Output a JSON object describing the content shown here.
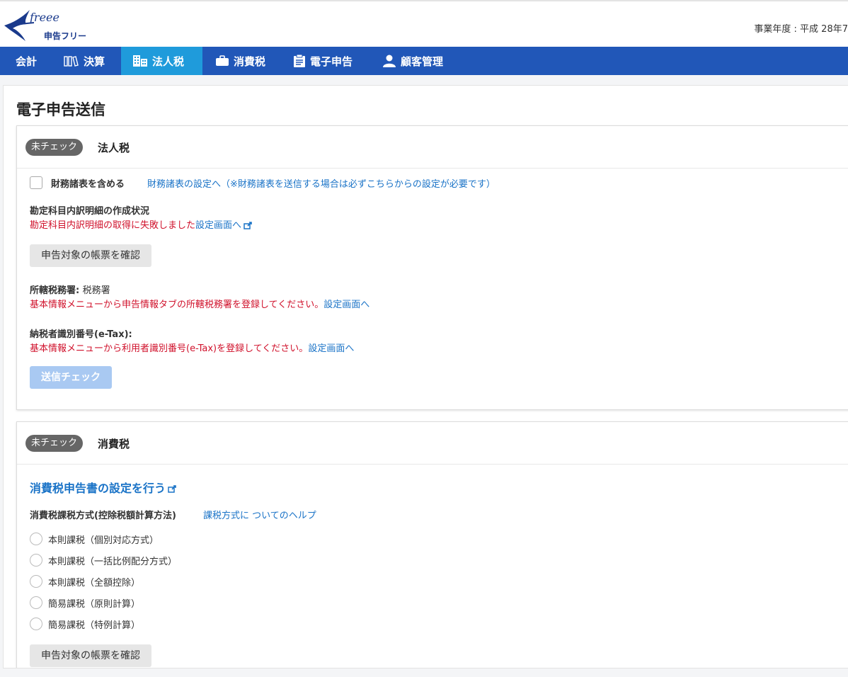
{
  "header": {
    "logo_script": "freee",
    "logo_sub": "申告フリー",
    "fiscal_year": "事業年度 : 平成 28年7"
  },
  "nav": {
    "items": [
      {
        "label": "会計",
        "icon": ""
      },
      {
        "label": "決算",
        "icon": "books-icon"
      },
      {
        "label": "法人税",
        "icon": "building-icon"
      },
      {
        "label": "消費税",
        "icon": "briefcase-icon"
      },
      {
        "label": "電子申告",
        "icon": "clipboard-icon"
      },
      {
        "label": "顧客管理",
        "icon": "user-icon"
      }
    ],
    "active": "法人税"
  },
  "page": {
    "title": "電子申告送信"
  },
  "corporate": {
    "badge": "未チェック",
    "title": "法人税",
    "include_financials_label": "財務諸表を含める",
    "financials_link": "財務諸表の設定へ（※財務諸表を送信する場合は必ずこちらからの設定が必要です）",
    "detail_heading": "勘定科目内訳明細の作成状況",
    "detail_error": "勘定科目内訳明細の取得に失敗しました",
    "detail_link": "設定画面へ",
    "confirm_button": "申告対象の帳票を確認",
    "tax_office_label": "所轄税務署:",
    "tax_office_value": "税務署",
    "tax_office_error": "基本情報メニューから申告情報タブの所轄税務署を登録してください。",
    "tax_office_link": "設定画面へ",
    "taxpayer_id_label": "納税者識別番号(e-Tax):",
    "taxpayer_id_error": "基本情報メニューから利用者識別番号(e-Tax)を登録してください。",
    "taxpayer_id_link": "設定画面へ",
    "send_check_button": "送信チェック"
  },
  "consumption": {
    "badge": "未チェック",
    "title": "消費税",
    "settings_link": "消費税申告書の設定を行う",
    "method_label": "消費税課税方式(控除税額計算方法)",
    "method_help_link": "課税方式に ついてのヘルプ",
    "options": [
      "本則課税（個別対応方式）",
      "本則課税（一括比例配分方式）",
      "本則課税（全額控除）",
      "簡易課税（原則計算）",
      "簡易課税（特例計算）"
    ],
    "confirm_button": "申告対象の帳票を確認"
  },
  "colors": {
    "nav_bg": "#2157b8",
    "nav_active": "#1f9bdb",
    "link": "#1a73c7",
    "error": "#d0112b",
    "badge": "#666666"
  }
}
